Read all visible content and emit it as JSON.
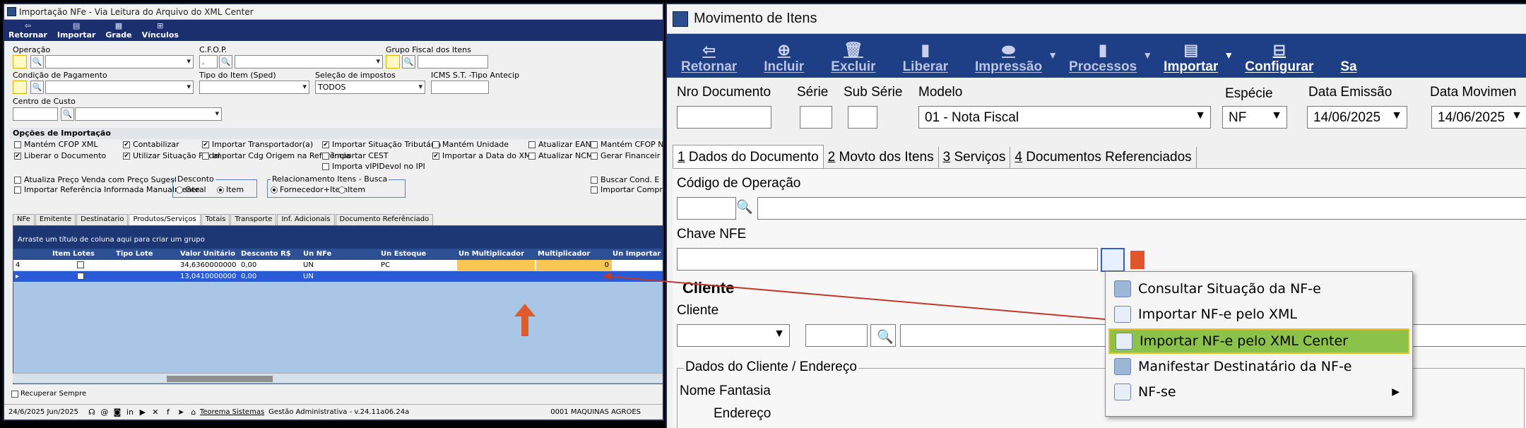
{
  "left": {
    "title": "Importação NFe - Via Leitura do Arquivo do XML Center",
    "toolbar": [
      {
        "label": "Retornar",
        "icon": "back-arrow-icon",
        "glyph": "⇦"
      },
      {
        "label": "Importar",
        "icon": "document-icon",
        "glyph": "▤"
      },
      {
        "label": "Grade",
        "icon": "grid-icon",
        "glyph": "▦"
      },
      {
        "label": "Vínculos",
        "icon": "link-icon",
        "glyph": "⊞"
      }
    ],
    "form": {
      "operacao": "Operação",
      "cfop": "C.F.O.P.",
      "cfop_value": ".",
      "grupo_fiscal": "Grupo Fiscal dos Itens",
      "condicao": "Condição de Pagamento",
      "tipo_item": "Tipo do Item (Sped)",
      "selecao_impostos": "Seleção de impostos",
      "selecao_value": "TODOS",
      "icms_st": "ICMS S.T. -Tipo Antecip",
      "centro_custo": "Centro de Custo"
    },
    "options_header": "Opções de Importação",
    "options": [
      {
        "label": "Mantém CFOP XML",
        "checked": false
      },
      {
        "label": "Liberar o Documento",
        "checked": true
      },
      {
        "label": "Contabilizar",
        "checked": true
      },
      {
        "label": "Utilizar Situação Fiscal",
        "checked": true
      },
      {
        "label": "Importar Transportador(a)",
        "checked": true
      },
      {
        "label": "Importar Cdg Origem na Referência",
        "checked": false
      },
      {
        "label": "Importar Situação Tributária",
        "checked": true
      },
      {
        "label": "Importar CEST",
        "checked": false
      },
      {
        "label": "Importa vIPIDevol no IPI",
        "checked": false
      },
      {
        "label": "Mantém Unidade",
        "checked": false
      },
      {
        "label": "Importar a Data do XML",
        "checked": true
      },
      {
        "label": "Atualizar EAN",
        "checked": false
      },
      {
        "label": "Atualizar NCM",
        "checked": false
      },
      {
        "label": "Mantém CFOP N",
        "checked": false
      },
      {
        "label": "Gerar Financeir",
        "checked": false
      },
      {
        "label": "Atualiza Preço Venda com Preço Sugestão",
        "checked": false
      },
      {
        "label": "Importar Referência Informada Manualmente",
        "checked": false
      },
      {
        "label": "Buscar Cond. E",
        "checked": false
      },
      {
        "label": "Importar Compr",
        "checked": false
      }
    ],
    "desconto": {
      "label": "Desconto",
      "geral": "Geral",
      "item": "Item"
    },
    "relacionamento": {
      "label": "Relacionamento Itens - Busca",
      "fornecedor": "Fornecedor+Item",
      "item": "Item"
    },
    "tabs": [
      "NFe",
      "Emitente",
      "Destinatario",
      "Produtos/Serviços",
      "Totais",
      "Transporte",
      "Inf. Adicionais",
      "Documento Referênciado"
    ],
    "grid_hint": "Arraste um título de coluna aqui para criar um grupo",
    "columns": [
      "Item Lotes",
      "Tipo Lote",
      "Valor Unitário",
      "Desconto R$",
      "Un NFe",
      "Un Estoque",
      "Un Multiplicador",
      "Multiplicador",
      "Un Importar"
    ],
    "rows": [
      {
        "num": "4",
        "valor": "34,6360000000",
        "desconto": "0,00",
        "un_nfe": "UN",
        "un_estoque": "PC",
        "multiplicador": "0"
      },
      {
        "num": "",
        "valor": "13,0410000000",
        "desconto": "0,00",
        "un_nfe": "UN",
        "un_estoque": "",
        "multiplicador": ""
      }
    ],
    "recuperar": "Recuperar Sempre",
    "status": {
      "date": "24/6/2025 Jun/2025",
      "brand": "Teorema Sistemas",
      "version": "Gestão Administrativa - v.24.11a06.24a",
      "company": "0001 MAQUINAS AGROES"
    }
  },
  "right": {
    "title": "Movimento de Itens",
    "toolbar": [
      {
        "label": "Retornar",
        "icon": "back-arrow-icon",
        "glyph": "⇦",
        "enabled": false
      },
      {
        "label": "Incluir",
        "icon": "add-icon",
        "glyph": "⊕",
        "enabled": false
      },
      {
        "label": "Excluir",
        "icon": "trash-icon",
        "glyph": "🗑",
        "enabled": false
      },
      {
        "label": "Liberar",
        "icon": "document-icon",
        "glyph": "▮",
        "enabled": false
      },
      {
        "label": "Impressão",
        "icon": "printer-icon",
        "glyph": "⬬",
        "enabled": false
      },
      {
        "label": "Processos",
        "icon": "process-icon",
        "glyph": "▮",
        "enabled": false
      },
      {
        "label": "Importar",
        "icon": "import-icon",
        "glyph": "▤",
        "enabled": true
      },
      {
        "label": "Configurar",
        "icon": "config-icon",
        "glyph": "⊟",
        "enabled": true
      },
      {
        "label": "Sa",
        "icon": "exit-icon",
        "glyph": "",
        "enabled": true
      }
    ],
    "fields": {
      "nro_documento": "Nro Documento",
      "serie": "Série",
      "sub_serie": "Sub Série",
      "modelo": "Modelo",
      "modelo_value": "01 - Nota Fiscal",
      "especie": "Espécie",
      "especie_value": "NF",
      "data_emissao": "Data Emissão",
      "data_emissao_value": "14/06/2025",
      "data_movimento": "Data Movimen",
      "data_movimento_value": "14/06/2025"
    },
    "tabs": [
      {
        "num": "1",
        "label": " Dados do Documento"
      },
      {
        "num": "2",
        "label": " Movto dos Itens"
      },
      {
        "num": "3",
        "label": " Serviços"
      },
      {
        "num": "4",
        "label": " Documentos Referenciados"
      }
    ],
    "codigo_operacao": "Código de Operação",
    "chave_nfe": "Chave NFE",
    "cliente_section": "Cliente",
    "cliente": "Cliente",
    "dados_cliente": "Dados do Cliente / Endereço",
    "nome_fantasia": "Nome Fantasia",
    "endereco": "Endereço",
    "menu": [
      {
        "label": "Consultar Situação da NF-e",
        "icon": "nfe-query-icon",
        "selected": false,
        "submenu": false
      },
      {
        "label": "Importar NF-e pelo XML",
        "icon": "xml-file-icon",
        "selected": false,
        "submenu": false
      },
      {
        "label": "Importar NF-e pelo XML Center",
        "icon": "xml-file-icon",
        "selected": true,
        "submenu": false
      },
      {
        "label": "Manifestar Destinatário da NF-e",
        "icon": "nfe-query-icon",
        "selected": false,
        "submenu": false
      },
      {
        "label": "NF-se",
        "icon": "xml-file-icon",
        "selected": false,
        "submenu": true
      }
    ]
  },
  "colors": {
    "accent_arrow": "#e05a2b",
    "selected_menu": "#8bc34a",
    "toolbar_blue": "#1e3f86",
    "grid_yellow": "#f9c74f"
  }
}
